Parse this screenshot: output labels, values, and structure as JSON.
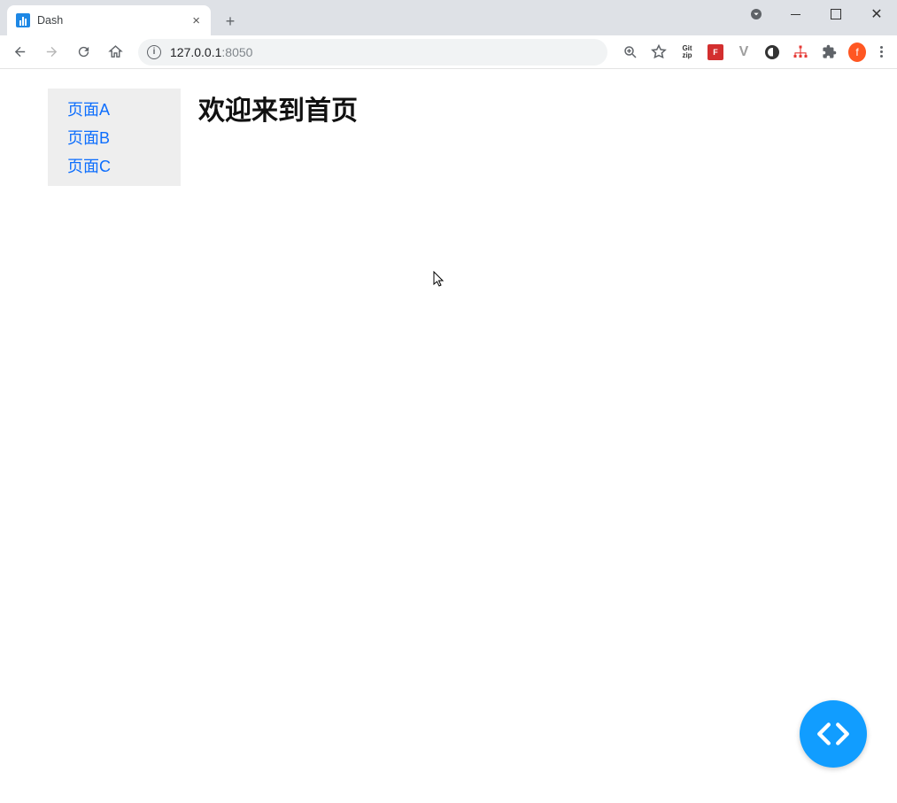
{
  "browser": {
    "tab_title": "Dash",
    "url_host": "127.0.0.1",
    "url_port": ":8050"
  },
  "toolbar_icons": {
    "gitzip": "Git\nzip",
    "pdf": "F",
    "v": "V",
    "avatar_letter": "f"
  },
  "sidebar": {
    "links": [
      "页面A",
      "页面B",
      "页面C"
    ]
  },
  "content": {
    "heading": "欢迎来到首页"
  }
}
